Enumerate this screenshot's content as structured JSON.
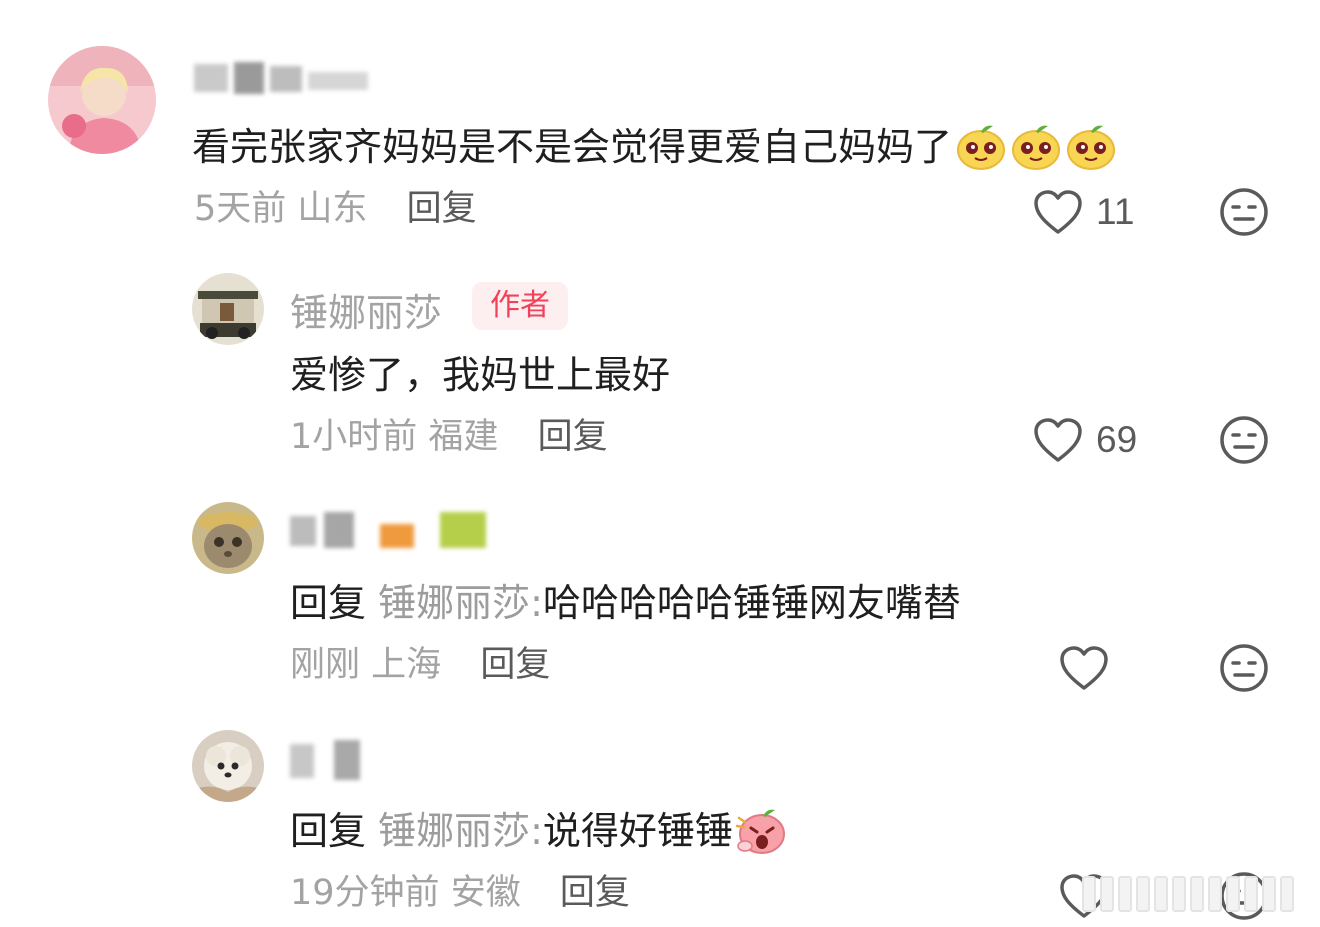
{
  "comments": [
    {
      "username": "",
      "text": "看完张家齐妈妈是不是会觉得更爱自己妈妈了",
      "emojis": [
        "smug-face-emoji",
        "smug-face-emoji",
        "smug-face-emoji"
      ],
      "time": "5天前",
      "location": "山东",
      "reply_label": "回复",
      "likes": "11"
    },
    {
      "username": "锤娜丽莎",
      "badge": "作者",
      "text": "爱惨了，我妈世上最好",
      "time": "1小时前",
      "location": "福建",
      "reply_label": "回复",
      "likes": "69"
    },
    {
      "username": "",
      "reply_prefix": "回复",
      "reply_target": "锤娜丽莎:",
      "text": "哈哈哈哈哈锤锤网友嘴替",
      "time": "刚刚",
      "location": "上海",
      "reply_label": "回复",
      "likes": ""
    },
    {
      "username": "",
      "reply_prefix": "回复",
      "reply_target": "锤娜丽莎:",
      "text": "说得好锤锤",
      "emojis": [
        "shouting-face-emoji"
      ],
      "time": "19分钟前",
      "location": "安徽",
      "reply_label": "回复",
      "likes": ""
    }
  ],
  "colors": {
    "muted": "#a3a3a3",
    "badge_text": "#f0425b",
    "badge_bg": "#fdeff0",
    "text": "#1f1f1f"
  },
  "icons": {
    "like": "heart-outline-icon",
    "dislike": "meh-face-icon"
  }
}
